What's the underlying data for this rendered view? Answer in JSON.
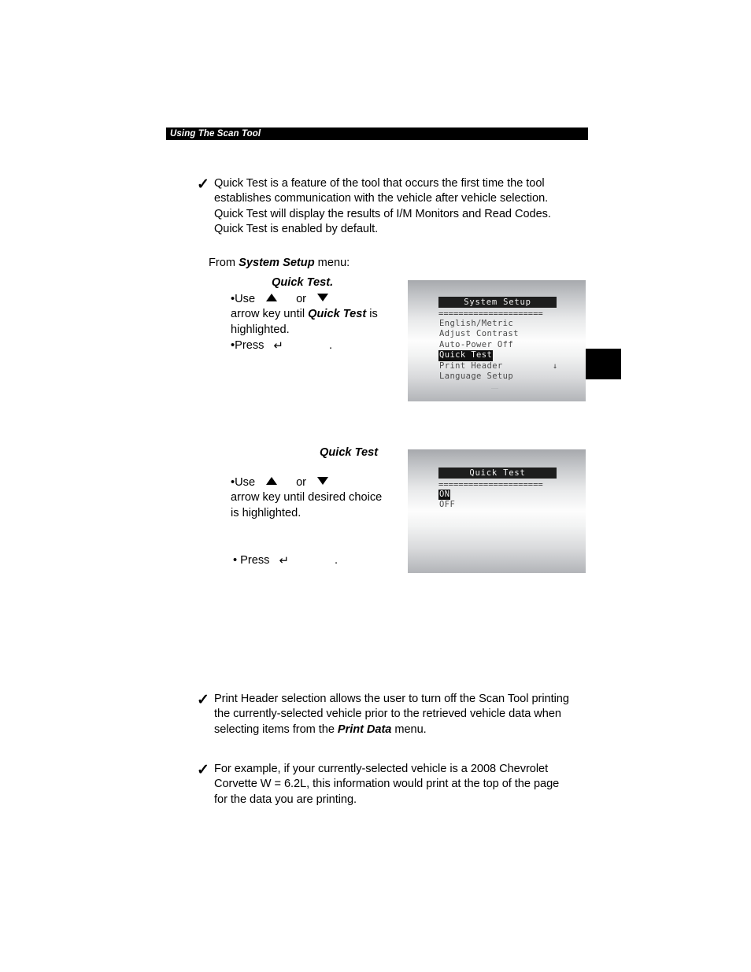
{
  "header": {
    "running_title": "Using The Scan Tool"
  },
  "paragraphs": {
    "quick_test_intro": {
      "bullet_icon": "checkmark-icon",
      "text_before_bold": "Quick Test is a feature of the tool that occurs the first time the tool establishes communication with the vehicle after vehicle selection. Quick Test will display the results of I/M Monitors and Read Codes. Quick Test is enabled by default."
    },
    "print_header_intro": {
      "bullet_icon": "checkmark-icon",
      "part1": "Print Header selection allows the user to turn off the Scan Tool printing the currently-selected vehicle prior to the retrieved vehicle data when selecting items from the ",
      "emphasis": "Print Data",
      "part2": " menu."
    },
    "example": {
      "bullet_icon": "checkmark-icon",
      "text": "For example, if your currently-selected vehicle is a 2008 Chevrolet Corvette W = 6.2L, this information would print at the top of the page for the data you are printing."
    }
  },
  "instructions": {
    "from_line": {
      "prefix": "From ",
      "emphasis": "System Setup",
      "suffix": " menu:"
    },
    "step1": {
      "heading": "Quick Test.",
      "bullet1_prefix": "•Use",
      "bullet1_or": "or",
      "bullet1_up_icon": "triangle-up-icon",
      "bullet1_down_icon": "triangle-down-icon",
      "bullet1_cont_prefix": "arrow key until ",
      "bullet1_cont_emphasis": "Quick Test",
      "bullet1_cont_suffix": " is",
      "bullet1_cont2": "highlighted.",
      "bullet2_prefix": "•Press",
      "bullet2_key_icon": "enter-key-icon",
      "bullet2_key_glyph": "↵",
      "bullet2_suffix": "."
    },
    "step2": {
      "heading": "Quick Test",
      "bullet1_prefix": "•Use",
      "bullet1_or": "or",
      "bullet1_up_icon": "triangle-up-icon",
      "bullet1_down_icon": "triangle-down-icon",
      "bullet1_cont": "arrow key until desired choice",
      "bullet1_cont2": "is highlighted.",
      "bullet2_prefix": "• Press",
      "bullet2_key_glyph": "↵",
      "bullet2_suffix": "."
    }
  },
  "lcd_screens": [
    {
      "id": "system-setup",
      "title": "System Setup",
      "separator": "=====================",
      "items": [
        {
          "label": "English/Metric",
          "selected": false,
          "more_arrow": ""
        },
        {
          "label": "Adjust Contrast",
          "selected": false,
          "more_arrow": ""
        },
        {
          "label": "Auto-Power Off",
          "selected": false,
          "more_arrow": ""
        },
        {
          "label": "Quick Test",
          "selected": true,
          "more_arrow": ""
        },
        {
          "label": "Print Header",
          "selected": false,
          "more_arrow": "↓"
        },
        {
          "label": "Language Setup",
          "selected": false,
          "more_arrow": ""
        }
      ]
    },
    {
      "id": "quick-test",
      "title": "Quick Test",
      "separator": "=====================",
      "items": [
        {
          "label": "ON",
          "selected": true,
          "more_arrow": ""
        },
        {
          "label": "OFF",
          "selected": false,
          "more_arrow": ""
        }
      ]
    }
  ],
  "colors": {
    "page_background": "#ffffff",
    "text": "#000000",
    "header_bar_background": "#000000",
    "header_bar_text": "#ffffff",
    "lcd_highlight_background": "#101010",
    "lcd_highlight_text": "#f4f4f4",
    "edge_tab": "#000000"
  }
}
